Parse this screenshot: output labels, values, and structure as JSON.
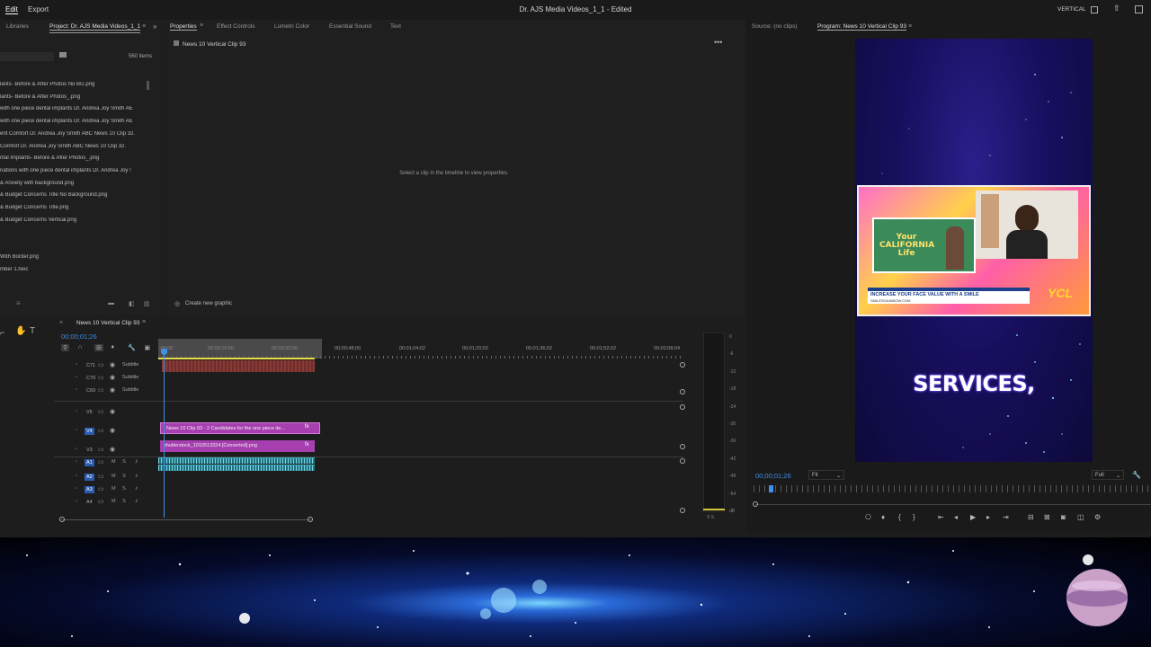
{
  "menu": {
    "edit": "Edit",
    "export": "Export",
    "title": "Dr. AJS Media Videos_1_1 - Edited",
    "workspace": "VERTICAL"
  },
  "project": {
    "tab_libraries": "Libraries",
    "tab_project": "Project: Dr. AJS Media Videos_1_1",
    "count": "560 items",
    "items": [
      "lants-  Before & After Photos No BG.png",
      "lants-  Before & After Photos_.png",
      "with one piece dental implants Dr. Andrea Joy Smith AE",
      "with one piece dental implants Dr. Andrea Joy Smith AE",
      "ent Comfort Dr. Andrea Joy Smith ABC News 10 Clip 32.",
      "Comfort Dr. Andrea Joy Smith ABC News 10 Clip 32.",
      "ntal  Implants-  Before & After Photos_.png",
      "nations with one piece dental implants Dr. Andrea Joy !",
      "& Anxiety with background.png",
      "& Budget  Concerns Title No Background.png",
      "& Budget  Concerns Title.png",
      "& Budget  Concerns Vertical.png",
      "",
      "",
      "With Border.png",
      "mber 1.heic"
    ]
  },
  "properties": {
    "tabs": [
      "Properties",
      "Effect Controls",
      "Lumetri Color",
      "Essential Sound",
      "Text"
    ],
    "clip_title": "News 10 Vertical Clip 93",
    "empty_msg": "Select a clip in the timeline to view properties.",
    "create_graphic": "Create new graphic"
  },
  "source": {
    "tab_source": "Source: (no clips)",
    "tab_program": "Program: News 10 Vertical Clip 93"
  },
  "program": {
    "caption": "SERVICES,",
    "timecode": "00;00;01;26",
    "fit": "Fit",
    "quality": "Full"
  },
  "timeline": {
    "tab": "News 10 Vertical Clip 93",
    "timecode": "00;00;01;26",
    "ruler": [
      ":00;00",
      "00;00;16;00",
      "00;00;32;00",
      "00;00;48;00",
      "00;01;04;02",
      "00;01;20;02",
      "00;01;36;02",
      "00;01;52;02",
      "00;02;08;04"
    ],
    "tracks": [
      {
        "id": "C71",
        "name": "Subtitle"
      },
      {
        "id": "C70",
        "name": "Subtitle"
      },
      {
        "id": "C69",
        "name": "Subtitle"
      },
      {
        "id": "V5",
        "name": ""
      },
      {
        "id": "V4",
        "name": ""
      },
      {
        "id": "V3",
        "name": ""
      },
      {
        "id": "A1",
        "name": "M S"
      },
      {
        "id": "A2",
        "name": "M S"
      },
      {
        "id": "A3",
        "name": "M S"
      },
      {
        "id": "A4",
        "name": "M S"
      }
    ],
    "clip_v4": "News 10 Clip 93 - 2 Candidates for the one piece de...",
    "clip_v3": "shutterstock_1010513324 [Converted].png",
    "fx": "fx"
  },
  "meter": [
    "0",
    "-6",
    "-12",
    "-18",
    "-24",
    "-30",
    "-36",
    "-42",
    "-48",
    "-54",
    "dB"
  ],
  "meter_s": "S  S",
  "thumb": {
    "brand": "Your CALIFORNIA Life",
    "banner": "INCREASE YOUR FACE VALUE WITH A SMILE",
    "url": "SMILESGAINNOW.COM",
    "logo": "YCL"
  },
  "colors": {
    "accent": "#3d8fe8",
    "clip_pink": "#a73fb0",
    "audio": "#2b8a9a",
    "subtitle": "#8a3a36"
  }
}
